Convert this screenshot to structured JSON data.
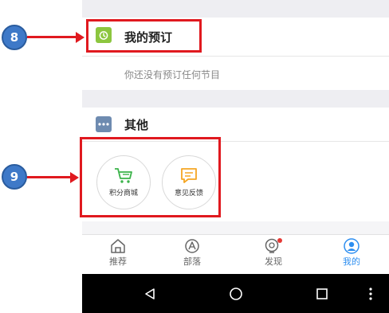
{
  "callouts": [
    {
      "number": "8"
    },
    {
      "number": "9"
    }
  ],
  "reservations": {
    "title": "我的预订",
    "empty_text": "你还没有预订任何节目",
    "icon": "alarm-clock-icon",
    "icon_color": "#8cc63f"
  },
  "other": {
    "title": "其他",
    "icon": "more-dots-icon",
    "icon_color": "#6e8bb0",
    "items": [
      {
        "label": "积分商城",
        "icon": "shopping-cart-icon",
        "color": "#3bb34a"
      },
      {
        "label": "意见反馈",
        "icon": "feedback-bubble-icon",
        "color": "#f5a623"
      }
    ]
  },
  "bottom_nav": {
    "items": [
      {
        "label": "推荐",
        "icon": "home-icon",
        "active": false
      },
      {
        "label": "部落",
        "icon": "compass-icon",
        "active": false
      },
      {
        "label": "发现",
        "icon": "radar-icon",
        "active": false,
        "badge": true
      },
      {
        "label": "我的",
        "icon": "user-icon",
        "active": true
      }
    ],
    "active_color": "#2d8ef0",
    "badge_color": "#e53935"
  },
  "system_bar": {
    "buttons": [
      "back-icon",
      "home-circle-icon",
      "recents-square-icon",
      "menu-dots-icon"
    ]
  },
  "colors": {
    "highlight": "#e0191f",
    "callout_fill": "#3e79c8"
  }
}
